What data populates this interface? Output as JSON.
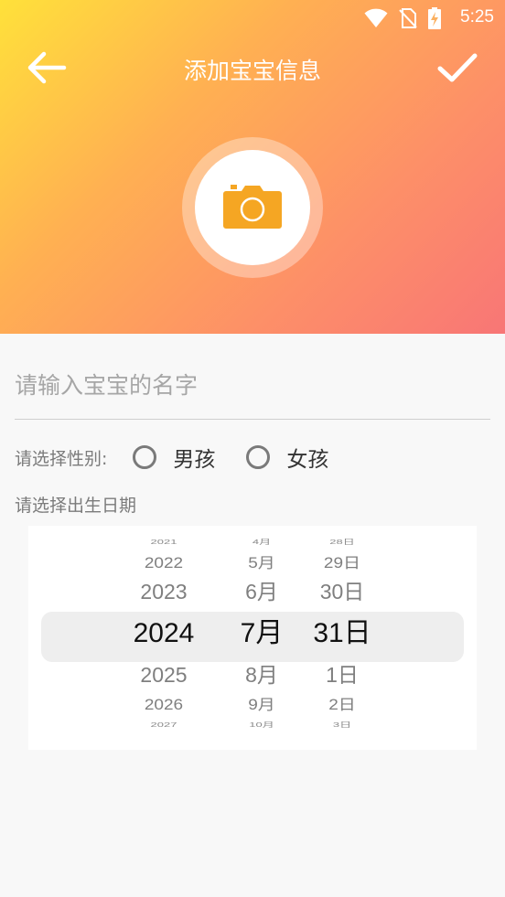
{
  "status_bar": {
    "time": "5:25"
  },
  "toolbar": {
    "title": "添加宝宝信息"
  },
  "form": {
    "name_placeholder": "请输入宝宝的名字",
    "gender_label": "请选择性别:",
    "gender_options": [
      "男孩",
      "女孩"
    ],
    "date_label": "请选择出生日期"
  },
  "date_picker": {
    "years": [
      "2021",
      "2022",
      "2023",
      "2024",
      "2025",
      "2026",
      "2027"
    ],
    "months": [
      "4月",
      "5月",
      "6月",
      "7月",
      "8月",
      "9月",
      "10月"
    ],
    "days": [
      "28日",
      "29日",
      "30日",
      "31日",
      "1日",
      "2日",
      "3日"
    ],
    "selected": {
      "year": "2024",
      "month": "7月",
      "day": "31日"
    }
  },
  "colors": {
    "header_gradient": [
      "#ffe13a",
      "#ffb052",
      "#fd8f68",
      "#f87676"
    ],
    "camera": "#f5a623"
  }
}
